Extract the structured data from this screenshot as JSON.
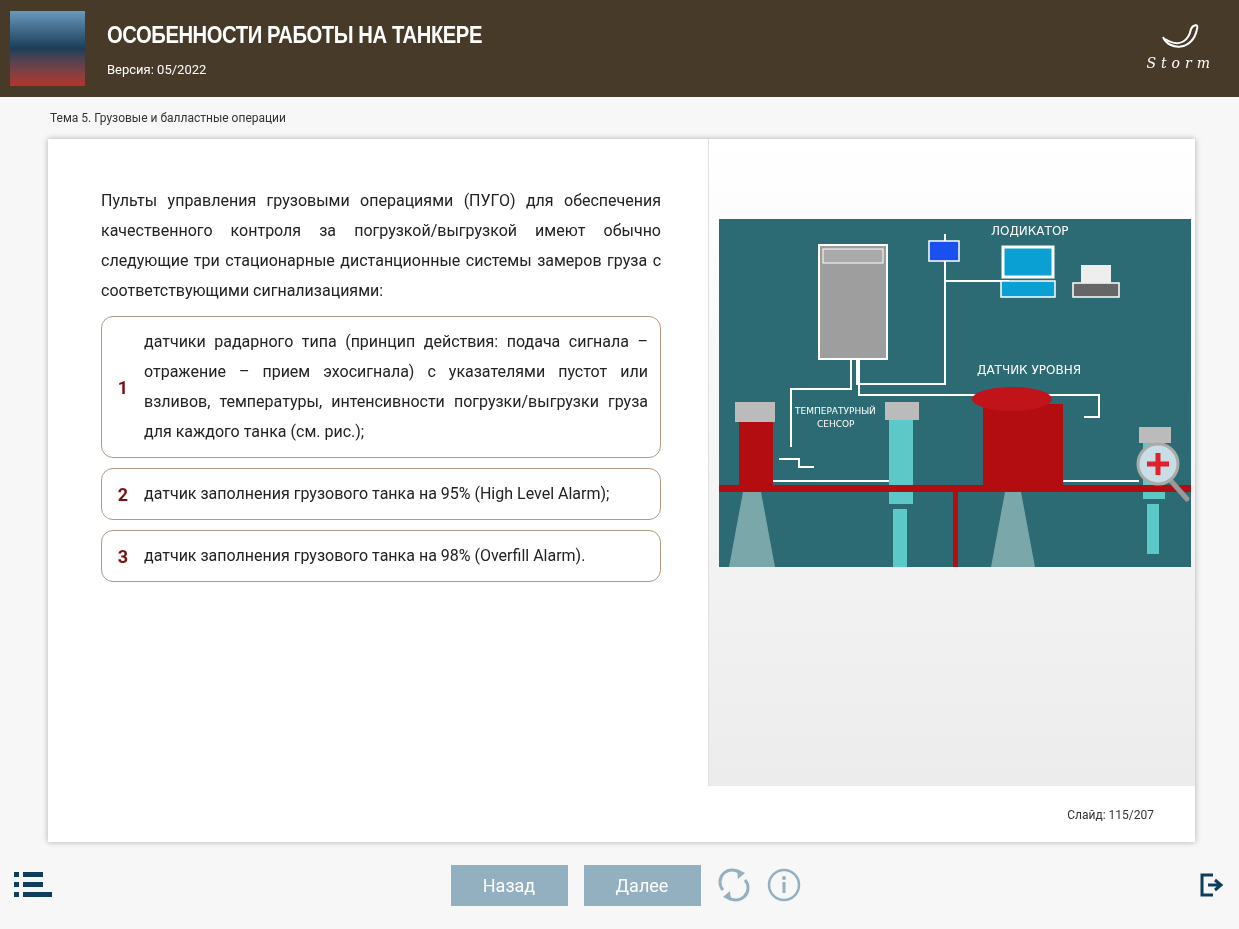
{
  "header": {
    "title": "ОСОБЕННОСТИ РАБОТЫ НА ТАНКЕРЕ",
    "version": "Версия: 05/2022",
    "logo_text": "Storm"
  },
  "breadcrumb": "Тема 5. Грузовые и балластные операции",
  "intro": "Пульты управления грузовыми операциями (ПУГО) для обеспечения качественного контроля за погрузкой/выгрузкой имеют обычно следующие три стационарные дистанционные системы замеров груза с соответствующими сигнализациями:",
  "items": [
    {
      "number": "1",
      "text": "датчики радарного типа (принцип действия: подача сигнала – отражение – прием эхосигнала) с указателями пустот или взливов, температуры, интенсивности погрузки/выгрузки груза для каждого танка (см. рис.);"
    },
    {
      "number": "2",
      "text": "датчик заполнения грузового танка на 95% (High Level Alarm);"
    },
    {
      "number": "3",
      "text": "датчик заполнения грузового танка на 98% (Overfill Alarm)."
    }
  ],
  "diagram": {
    "labels": [
      "ЛОДИКАТОР",
      "ДАТЧИК УРОВНЯ",
      "ТЕМПЕРАТУРНЫЙ",
      "СЕНСОР"
    ]
  },
  "slide_counter": "Слайд: 115/207",
  "nav": {
    "back": "Назад",
    "next": "Далее"
  }
}
